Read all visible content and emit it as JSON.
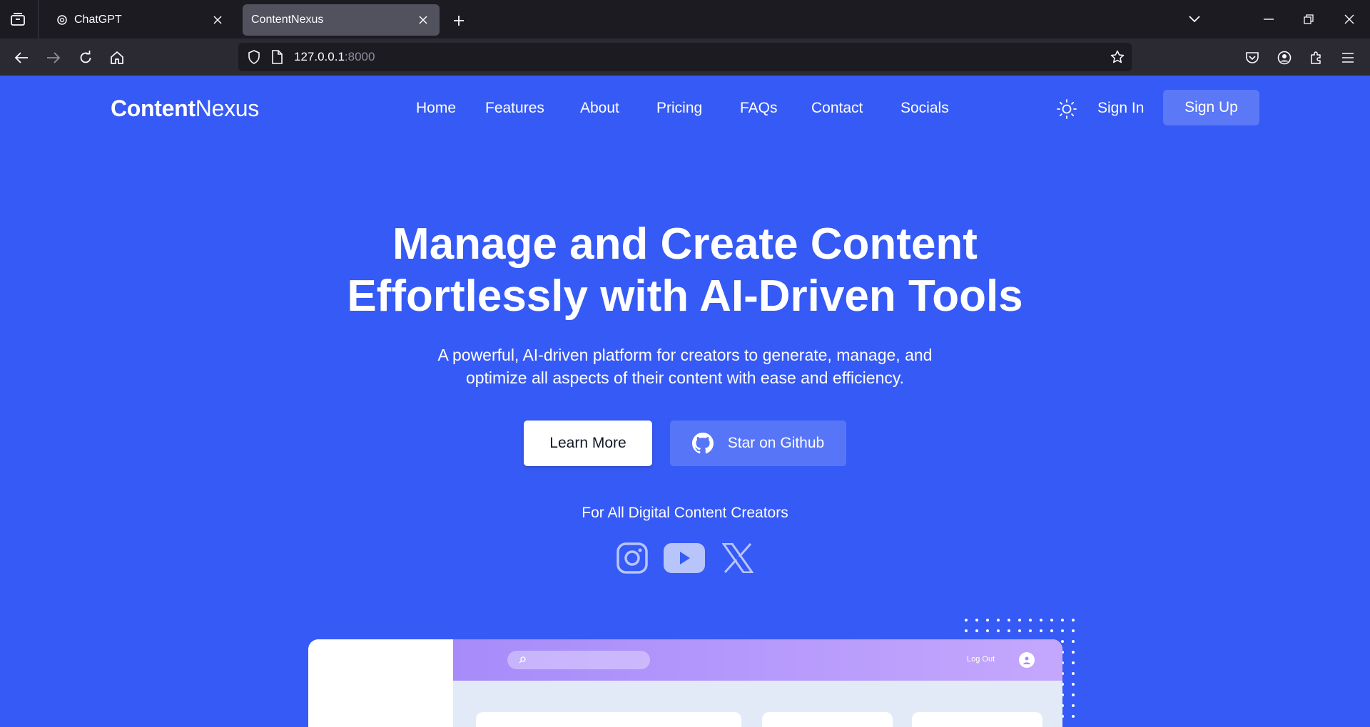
{
  "browser": {
    "tabs": [
      {
        "title": "ChatGPT",
        "icon": "chatgpt-icon",
        "active": false
      },
      {
        "title": "ContentNexus",
        "icon": "",
        "active": true
      }
    ],
    "url_host": "127.0.0.1",
    "url_port": ":8000"
  },
  "site": {
    "logo_bold": "Content",
    "logo_light": "Nexus",
    "nav": [
      "Home",
      "Features",
      "About",
      "Pricing",
      "FAQs",
      "Contact",
      "Socials"
    ],
    "sign_in": "Sign In",
    "sign_up": "Sign Up"
  },
  "hero": {
    "title_line1": "Manage and Create Content",
    "title_line2": "Effortlessly with AI-Driven Tools",
    "subtitle_line1": "A powerful, AI-driven platform for creators to generate, manage, and",
    "subtitle_line2": "optimize all aspects of their content with ease and efficiency.",
    "learn_more": "Learn More",
    "github": "Star on Github",
    "for_all": "For All Digital Content Creators",
    "socials": [
      "instagram-icon",
      "youtube-icon",
      "x-icon"
    ]
  },
  "preview": {
    "logout": "Log Out"
  },
  "colors": {
    "brand_blue": "#365af5",
    "button_blue": "#5b78f7",
    "preview_header": "#a78bfa"
  }
}
